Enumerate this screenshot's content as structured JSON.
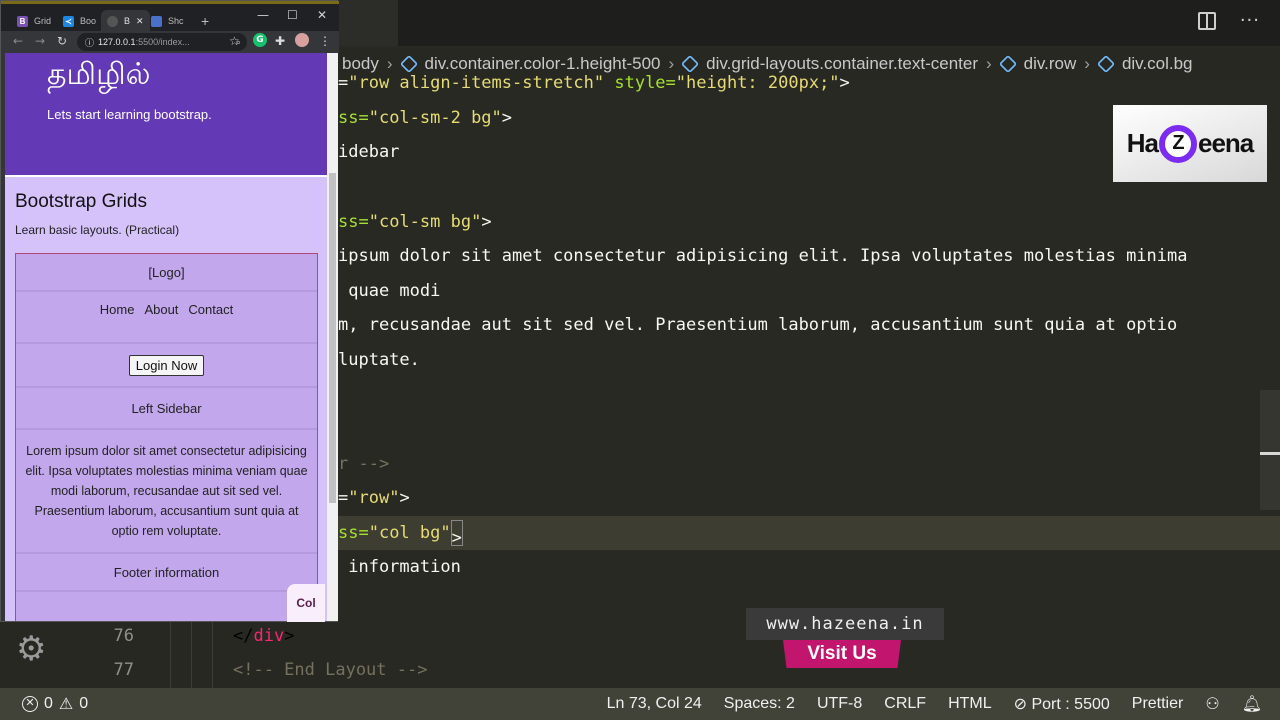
{
  "browser": {
    "tabs": [
      {
        "label": "Grid",
        "favicon": "bootstrap-icon",
        "color": "#7952b3"
      },
      {
        "label": "Boo",
        "favicon": "vscode-icon",
        "color": "#1e88e5"
      },
      {
        "label": "B",
        "favicon": "loading-icon",
        "color": "#555555",
        "active": true
      },
      {
        "label": "Shc",
        "favicon": "window-icon",
        "color": "#4a70c9"
      }
    ],
    "new_tab": "+",
    "url_host": "127.0.0.1",
    "url_rest": ":5500/index...",
    "window_controls": {
      "minimize": "—",
      "maximize": "☐",
      "close": "✕"
    }
  },
  "page": {
    "hero_title": "தமிழில்",
    "hero_subtitle": "Lets start learning bootstrap.",
    "section_title": "Bootstrap Grids",
    "section_subtitle": "Learn basic layouts. (Practical)",
    "grid": {
      "logo": "[Logo]",
      "nav": [
        "Home",
        "About",
        "Contact"
      ],
      "login_button": "Login Now",
      "sidebar": "Left Sidebar",
      "content": "Lorem ipsum dolor sit amet consectetur adipisicing elit. Ipsa voluptates molestias minima veniam quae modi laborum, recusandae aut sit sed vel. Praesentium laborum, accusantium sunt quia at optio rem voluptate.",
      "footer": "Footer information"
    },
    "popup_label": "Col"
  },
  "editor": {
    "breadcrumb": [
      "body",
      "div.container.color-1.height-500",
      "div.grid-layouts.container.text-center",
      "div.row",
      "div.col.bg"
    ],
    "code_lines": [
      {
        "pre": "=",
        "str": "\"row align-items-stretch\"",
        "mid": " style=",
        "str2": "\"height: 200px;\"",
        "post": ">"
      },
      {
        "pre": "ss=",
        "str": "\"col-sm-2 bg\"",
        "post": ">"
      },
      {
        "text": "idebar"
      },
      {
        "pre": "ss=",
        "str": "\"col-sm bg\"",
        "post": ">"
      },
      {
        "text": "ipsum dolor sit amet consectetur adipisicing elit. Ipsa voluptates molestias minima"
      },
      {
        "text": " quae modi"
      },
      {
        "text": "m, recusandae aut sit sed vel. Praesentium laborum, accusantium sunt quia at optio"
      },
      {
        "text": "luptate."
      },
      {
        "comment": "r -->"
      },
      {
        "pre": "=",
        "str": "\"row\"",
        "post": ">"
      },
      {
        "pre": "ss=",
        "str": "\"col bg\"",
        "post": ">"
      },
      {
        "text": " information"
      }
    ],
    "bottom_lines": [
      {
        "number": "76",
        "open": "</",
        "tag": "div",
        "close": ">"
      },
      {
        "number": "77",
        "comment": "<!-- End Layout -->"
      }
    ]
  },
  "overlay": {
    "logo_left": "Ha",
    "logo_z": "Z",
    "logo_right": "eena",
    "site": "www.hazeena.in",
    "visit": "Visit Us"
  },
  "statusbar": {
    "errors": "0",
    "warnings": "0",
    "position": "Ln 73, Col 24",
    "spaces": "Spaces: 2",
    "encoding": "UTF-8",
    "eol": "CRLF",
    "language": "HTML",
    "port": "Port : 5500",
    "formatter": "Prettier"
  }
}
